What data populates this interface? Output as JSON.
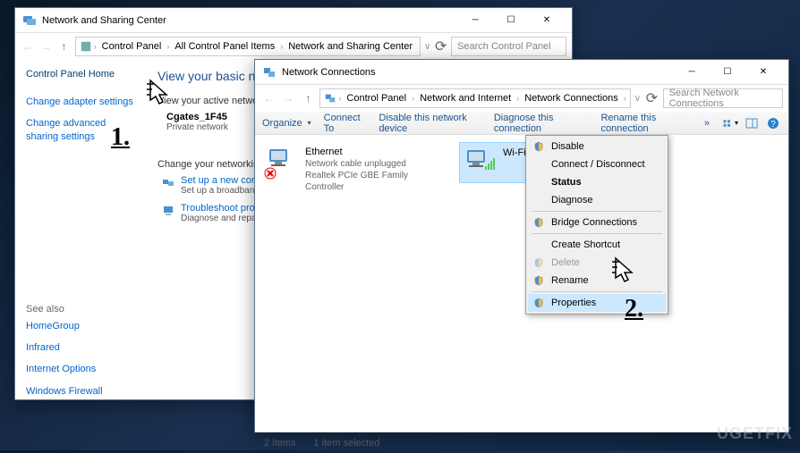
{
  "window1": {
    "title": "Network and Sharing Center",
    "breadcrumb": [
      "Control Panel",
      "All Control Panel Items",
      "Network and Sharing Center"
    ],
    "search_placeholder": "Search Control Panel",
    "sidebar": {
      "home": "Control Panel Home",
      "links": [
        "Change adapter settings",
        "Change advanced sharing settings"
      ],
      "see_also_label": "See also",
      "see_also": [
        "HomeGroup",
        "Infrared",
        "Internet Options",
        "Windows Firewall"
      ]
    },
    "main": {
      "heading": "View your basic network information and set up connections",
      "active_heading": "View your active networks",
      "network": {
        "name": "Cgates_1F45",
        "type": "Private network"
      },
      "change_heading": "Change your networking settings",
      "actions": [
        {
          "link": "Set up a new connection",
          "desc": "Set up a broadband"
        },
        {
          "link": "Troubleshoot problems",
          "desc": "Diagnose and repair"
        }
      ]
    }
  },
  "window2": {
    "title": "Network Connections",
    "breadcrumb": [
      "Control Panel",
      "Network and Internet",
      "Network Connections"
    ],
    "search_placeholder": "Search Network Connections",
    "toolbar": {
      "organize": "Organize",
      "connect": "Connect To",
      "disable": "Disable this network device",
      "diagnose": "Diagnose this connection",
      "rename": "Rename this connection",
      "more": "»"
    },
    "connections": [
      {
        "name": "Ethernet",
        "status": "Network cable unplugged",
        "device": "Realtek PCIe GBE Family Controller",
        "unplugged": true
      },
      {
        "name": "Wi-Fi",
        "status": "",
        "device": "",
        "selected": true
      }
    ],
    "context_menu": [
      {
        "label": "Disable",
        "shield": true
      },
      {
        "label": "Connect / Disconnect"
      },
      {
        "label": "Status",
        "bold": true
      },
      {
        "label": "Diagnose"
      },
      {
        "sep": true
      },
      {
        "label": "Bridge Connections",
        "shield": true
      },
      {
        "sep": true
      },
      {
        "label": "Create Shortcut"
      },
      {
        "label": "Delete",
        "shield": true,
        "disabled": true
      },
      {
        "label": "Rename",
        "shield": true
      },
      {
        "sep": true
      },
      {
        "label": "Properties",
        "shield": true,
        "highlighted": true
      }
    ],
    "status": {
      "items": "2 items",
      "selected": "1 item selected"
    }
  },
  "steps": {
    "one": "1.",
    "two": "2."
  },
  "watermark": "UGETFIX"
}
